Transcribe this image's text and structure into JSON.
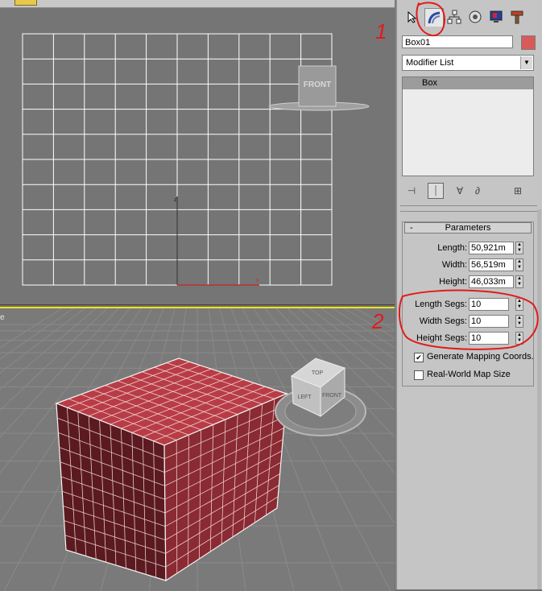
{
  "viewports": {
    "front_cube_label": "FRONT",
    "persp_label": "e",
    "viewcube": {
      "top": "TOP",
      "left": "LEFT",
      "front": "FRONT"
    }
  },
  "command_panel": {
    "tabs": [
      {
        "name": "create",
        "icon": "pointer-star-icon"
      },
      {
        "name": "modify",
        "icon": "modify-arc-icon"
      },
      {
        "name": "hierarchy",
        "icon": "hierarchy-icon"
      },
      {
        "name": "motion",
        "icon": "motion-icon"
      },
      {
        "name": "display",
        "icon": "display-monitor-icon"
      },
      {
        "name": "utilities",
        "icon": "hammer-icon"
      }
    ],
    "object_name": "Box01",
    "object_color": "#d95a5a",
    "modifier_list": "Modifier List",
    "stack_items": [
      "Box"
    ],
    "parameters": {
      "title": "Parameters",
      "collapse_glyph": "-",
      "length_label": "Length:",
      "length_value": "50,921m",
      "width_label": "Width:",
      "width_value": "56,519m",
      "height_label": "Height:",
      "height_value": "46,033m",
      "length_segs_label": "Length Segs:",
      "length_segs_value": "10",
      "width_segs_label": "Width Segs:",
      "width_segs_value": "10",
      "height_segs_label": "Height Segs:",
      "height_segs_value": "10",
      "gen_mapping_label": "Generate Mapping Coords.",
      "gen_mapping_checked": true,
      "real_world_label": "Real-World Map Size",
      "real_world_checked": false
    }
  },
  "annotations": {
    "mark1": "1",
    "mark2": "2"
  },
  "colors": {
    "viewport_bg": "#757575",
    "active_border": "#f2e21a",
    "box_red": "#a8343c",
    "annotation_red": "#e01b1b"
  }
}
